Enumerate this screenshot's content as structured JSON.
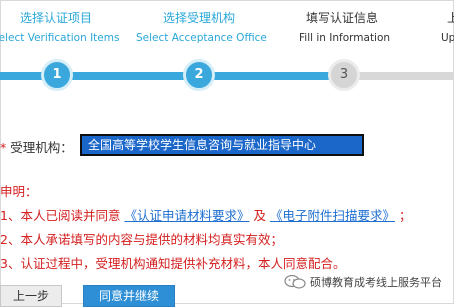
{
  "steps": [
    {
      "cn": "选择认证项目",
      "en": "Select Verification Items",
      "num": "1",
      "state": "done"
    },
    {
      "cn": "选择受理机构",
      "en": "Select Acceptance Office",
      "num": "2",
      "state": "done"
    },
    {
      "cn": "填写认证信息",
      "en": "Fill in Information",
      "num": "3",
      "state": "current"
    },
    {
      "cn": "上",
      "en": "Up"
    }
  ],
  "form": {
    "office_label_required": "*",
    "office_label": "受理机构：",
    "office_value": "全国高等学校学生信息咨询与就业指导中心"
  },
  "declaration": {
    "title": "申明：",
    "item1_prefix": "1、本人已阅读并同意",
    "item1_link1": "《认证申请材料要求》",
    "item1_mid": "及",
    "item1_link2": "《电子附件扫描要求》",
    "item1_suffix": "；",
    "item2": "2、本人承诺填写的内容与提供的材料均真实有效；",
    "item3": "3、认证过程中，受理机构通知提供补充材料，本人同意配合。"
  },
  "buttons": {
    "prev": "上一步",
    "next": "同意并继续"
  },
  "watermark": "硕博教育成考线上服务平台",
  "colors": {
    "accent": "#3aa8dc",
    "declaration_red": "#d42020",
    "link_blue": "#1e6fd0",
    "selected_input": "#1b66c9"
  }
}
